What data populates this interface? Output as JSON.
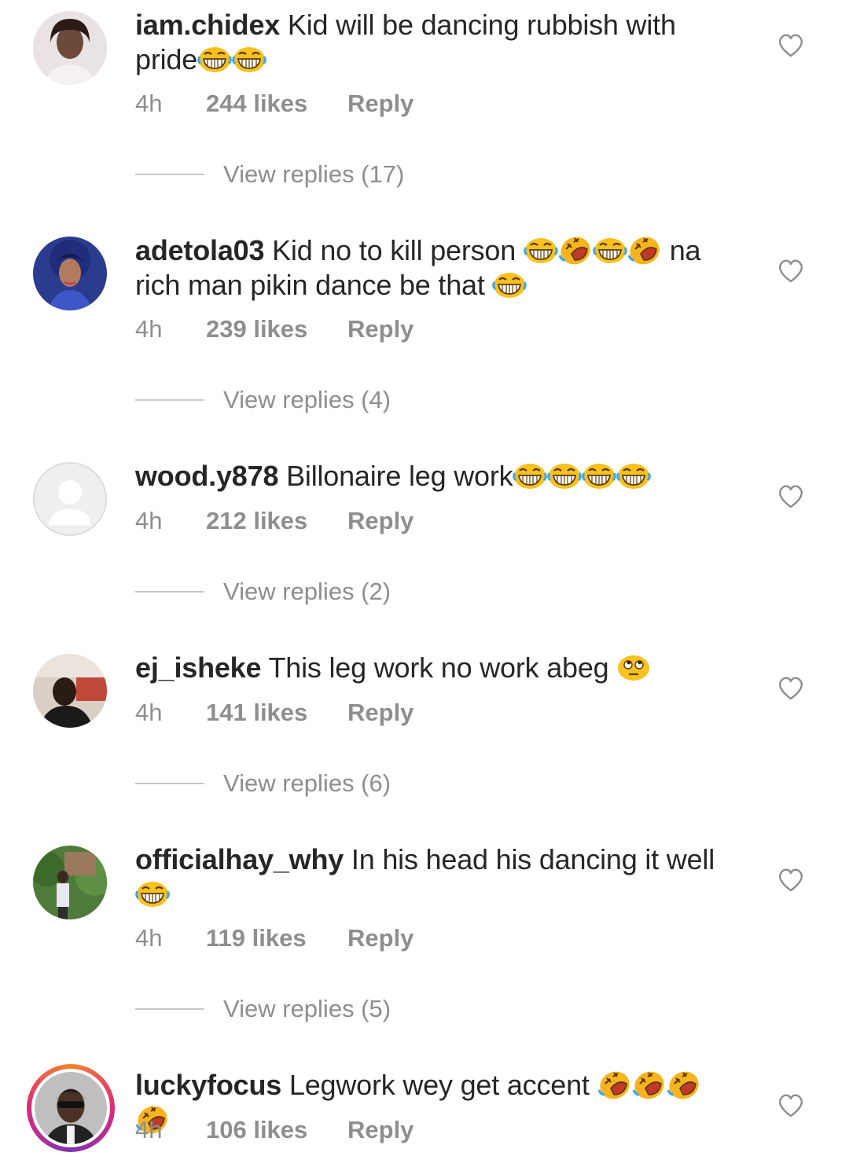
{
  "comments": [
    {
      "username": "iam.chidex",
      "text_line1": "Kid will be dancing rubbish with",
      "text_line2": "pride",
      "time": "4h",
      "likes": "244 likes",
      "reply": "Reply",
      "view_replies": "View replies (17)",
      "avatar_icon": "avatar-photo-woman"
    },
    {
      "username": "adetola03",
      "text_line1a": "Kid no to kill person",
      "text_line1b": "na",
      "text_line2": "rich man pikin dance be that",
      "time": "4h",
      "likes": "239 likes",
      "reply": "Reply",
      "view_replies": "View replies (4)",
      "avatar_icon": "avatar-photo-woman"
    },
    {
      "username": "wood.y878",
      "text_line1": "Billonaire leg work",
      "time": "4h",
      "likes": "212 likes",
      "reply": "Reply",
      "view_replies": "View replies (2)",
      "avatar_icon": "default-avatar-icon"
    },
    {
      "username": "ej_isheke",
      "text_line1": "This leg work no work abeg",
      "time": "4h",
      "likes": "141 likes",
      "reply": "Reply",
      "view_replies": "View replies (6)",
      "avatar_icon": "avatar-photo-man"
    },
    {
      "username": "officialhay_why",
      "text_line1": "In his head his dancing it well",
      "time": "4h",
      "likes": "119 likes",
      "reply": "Reply",
      "view_replies": "View replies (5)",
      "avatar_icon": "avatar-photo-outdoor"
    },
    {
      "username": "luckyfocus",
      "text_line1": "Legwork wey get accent",
      "time": "4h",
      "likes": "106 likes",
      "reply": "Reply",
      "avatar_icon": "avatar-photo-man-story"
    }
  ],
  "icons": {
    "like": "heart-outline-icon",
    "emoji_laugh": "grinning-squinting-tears-emoji",
    "emoji_rofl": "rolling-on-floor-laughing-emoji",
    "emoji_eyeroll": "face-with-rolling-eyes-emoji"
  },
  "colors": {
    "text": "#262626",
    "meta": "#8e8e8e",
    "divider": "#c7c7c7",
    "story_ring_start": "#f58529",
    "story_ring_end": "#dd2a7b"
  }
}
